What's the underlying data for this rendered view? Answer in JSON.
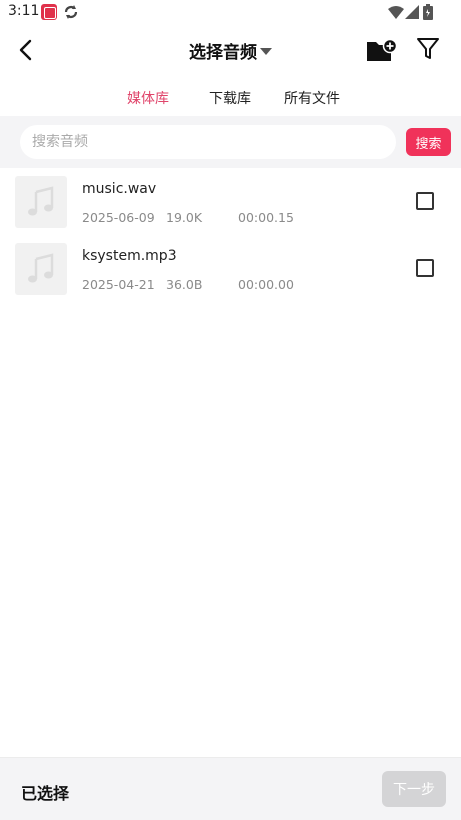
{
  "status_bar": {
    "time": "3:11",
    "icons": [
      "app-badge-icon",
      "sync-icon",
      "wifi-icon",
      "signal-icon",
      "battery-icon"
    ]
  },
  "header": {
    "title": "选择音频",
    "back_icon": "chevron-left-icon",
    "title_icon": "caret-down-icon",
    "actions": [
      "folder-add-icon",
      "filter-icon"
    ]
  },
  "tabs": [
    {
      "label": "媒体库",
      "active": true
    },
    {
      "label": "下载库",
      "active": false
    },
    {
      "label": "所有文件",
      "active": false
    }
  ],
  "search": {
    "placeholder": "搜索音频",
    "value": "",
    "button_label": "搜索"
  },
  "files": [
    {
      "name": "music.wav",
      "date": "2025-06-09",
      "size": "19.0K",
      "duration": "00:00.15",
      "checked": false,
      "icon": "music-note-icon"
    },
    {
      "name": "ksystem.mp3",
      "date": "2025-04-21",
      "size": "36.0B",
      "duration": "00:00.00",
      "checked": false,
      "icon": "music-note-icon"
    }
  ],
  "footer": {
    "selected_label": "已选择",
    "next_label": "下一步",
    "next_enabled": false
  },
  "colors": {
    "accent": "#f0325a",
    "active_tab": "#e0456b",
    "disabled_button": "#d4d4d6",
    "background_gray": "#f4f4f6"
  }
}
